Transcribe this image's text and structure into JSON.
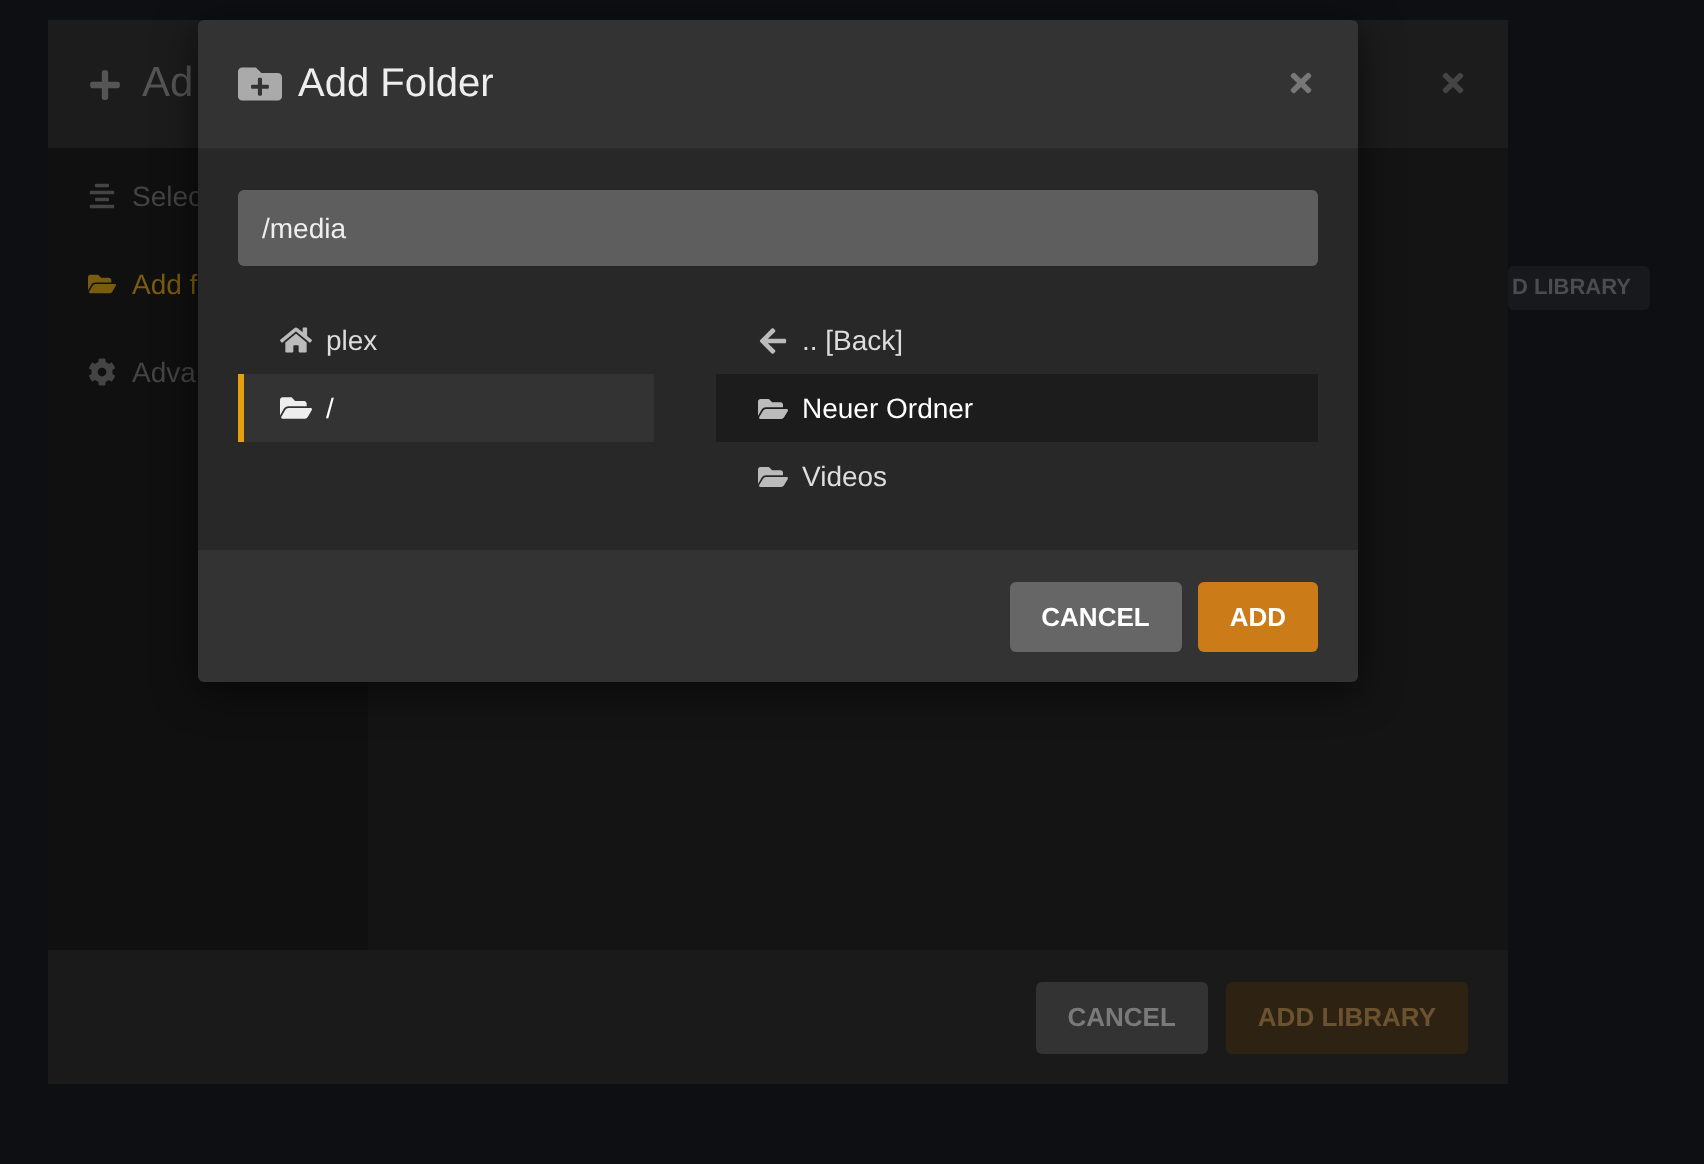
{
  "background_page": {
    "buttons": [
      {
        "label": "D LIBRARY"
      }
    ]
  },
  "library_dialog": {
    "title": "Ad",
    "sidebar": [
      {
        "label": "Selec",
        "kind": "list",
        "selected": false
      },
      {
        "label": "Add f",
        "kind": "folder",
        "selected": true
      },
      {
        "label": "Adva",
        "kind": "gear",
        "selected": false
      }
    ],
    "buttons": [
      {
        "label": "CANCEL",
        "kind": "secondary"
      },
      {
        "label": "ADD LIBRARY",
        "kind": "primary"
      }
    ]
  },
  "folder_dialog": {
    "title": "Add Folder",
    "path": "/media",
    "places": [
      {
        "label": "plex",
        "kind": "home",
        "selected": false
      },
      {
        "label": "/",
        "kind": "folder",
        "selected": true
      }
    ],
    "entries": [
      {
        "label": ".. [Back]",
        "kind": "back",
        "highlighted": false
      },
      {
        "label": "Neuer Ordner",
        "kind": "folder",
        "highlighted": true
      },
      {
        "label": "Videos",
        "kind": "folder",
        "highlighted": false
      }
    ],
    "buttons": [
      {
        "label": "CANCEL",
        "kind": "secondary"
      },
      {
        "label": "ADD",
        "kind": "primary"
      }
    ]
  }
}
